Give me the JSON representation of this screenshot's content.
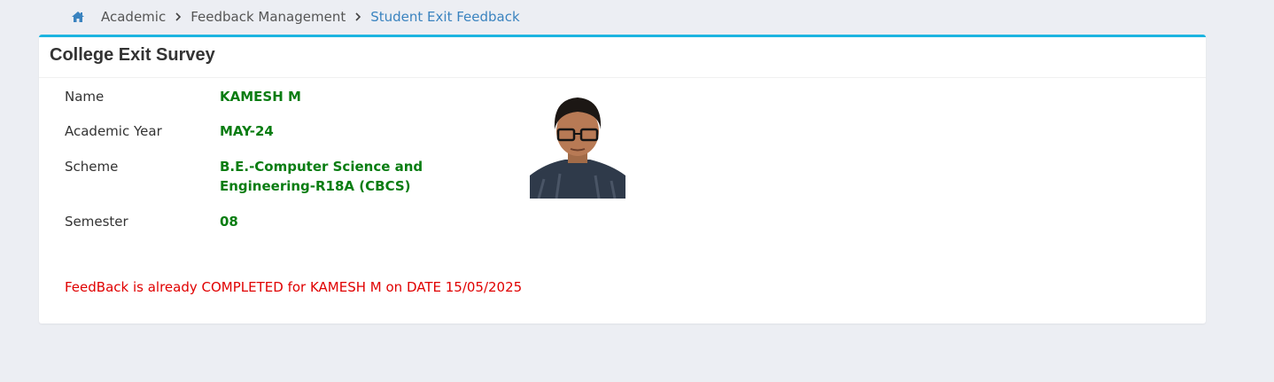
{
  "breadcrumb": {
    "items": [
      "Academic",
      "Feedback Management",
      "Student Exit Feedback"
    ]
  },
  "card": {
    "title": "College Exit Survey"
  },
  "student": {
    "name_label": "Name",
    "name_value": "KAMESH M",
    "year_label": "Academic Year",
    "year_value": "MAY-24",
    "scheme_label": "Scheme",
    "scheme_value": "B.E.-Computer Science and Engineering-R18A (CBCS)",
    "semester_label": "Semester",
    "semester_value": "08"
  },
  "status_message": "FeedBack is already COMPLETED for KAMESH M on DATE 15/05/2025",
  "colors": {
    "accent": "#1cb4e0",
    "value_green": "#0a7d12",
    "status_red": "#e00000",
    "breadcrumb_active": "#3a83bf"
  },
  "icons": {
    "home": "home-icon",
    "separator": "chevron-right-icon"
  }
}
